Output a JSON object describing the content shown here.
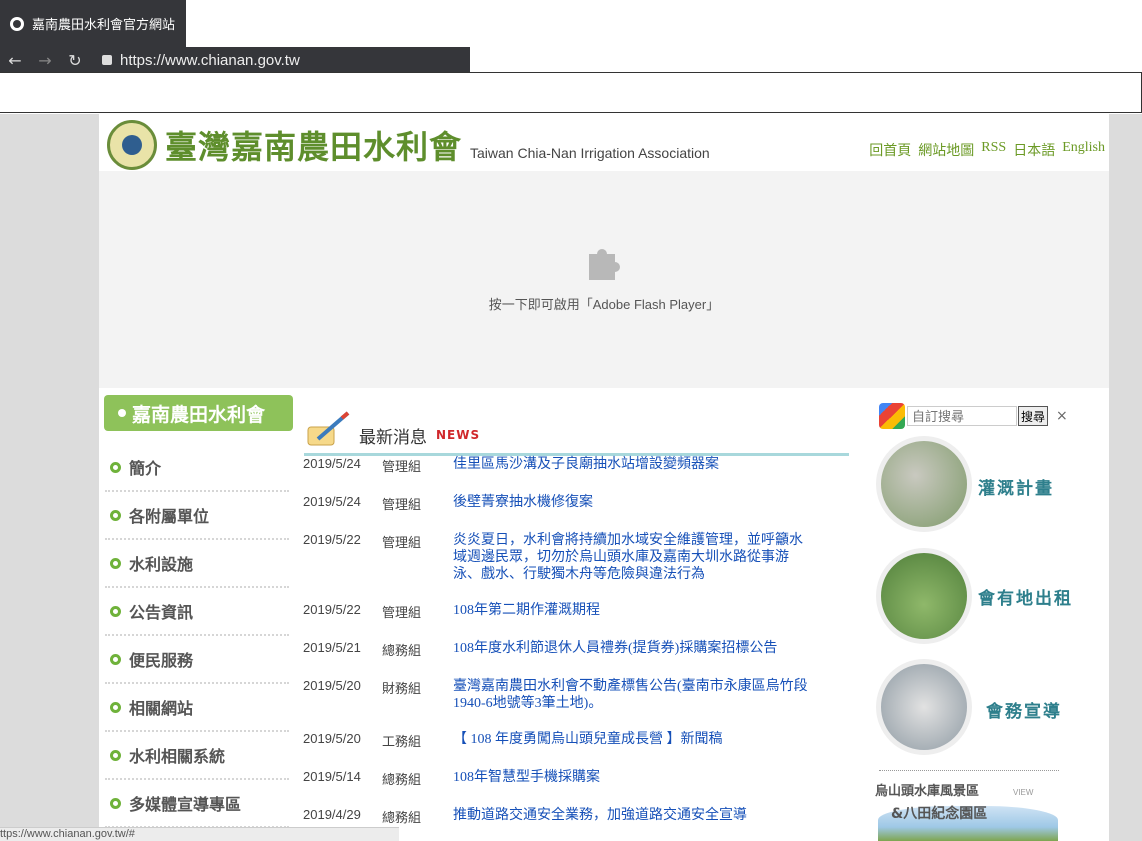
{
  "browser": {
    "tab_title": "嘉南農田水利會官方網站",
    "url": "https://www.chianan.gov.tw",
    "status_url": "ttps://www.chianan.gov.tw/#"
  },
  "header": {
    "logo_cn": "臺灣嘉南農田水利會",
    "logo_en": "Taiwan Chia-Nan Irrigation Association",
    "links": [
      "回首頁",
      "網站地圖",
      "RSS",
      "日本語",
      "English"
    ]
  },
  "flash": {
    "message": "按一下即可啟用「Adobe Flash Player」"
  },
  "sidebar": {
    "banner": "嘉南農田水利會",
    "items": [
      {
        "label": "簡介"
      },
      {
        "label": "各附屬單位"
      },
      {
        "label": "水利設施"
      },
      {
        "label": "公告資訊"
      },
      {
        "label": "便民服務"
      },
      {
        "label": "相關網站"
      },
      {
        "label": "水利相關系統"
      },
      {
        "label": "多媒體宣導專區"
      }
    ]
  },
  "news": {
    "title": "最新消息",
    "tag": "NEWS",
    "rows": [
      {
        "date": "2019/5/24",
        "dept": "管理組",
        "title": "佳里區馬沙溝及子良廟抽水站增設變頻器案"
      },
      {
        "date": "2019/5/24",
        "dept": "管理組",
        "title": "後壁菁寮抽水機修復案"
      },
      {
        "date": "2019/5/22",
        "dept": "管理組",
        "title": "炎炎夏日，水利會將持續加水域安全維護管理，並呼籲水域週邊民眾，切勿於烏山頭水庫及嘉南大圳水路從事游泳、戲水、行駛獨木舟等危險與違法行為"
      },
      {
        "date": "2019/5/22",
        "dept": "管理組",
        "title": "108年第二期作灌溉期程"
      },
      {
        "date": "2019/5/21",
        "dept": "總務組",
        "title": "108年度水利節退休人員禮券(提貨券)採購案招標公告"
      },
      {
        "date": "2019/5/20",
        "dept": "財務組",
        "title": "臺灣嘉南農田水利會不動產標售公告(臺南市永康區烏竹段1940-6地號等3筆土地)。"
      },
      {
        "date": "2019/5/20",
        "dept": "工務組",
        "title": "【 108 年度勇闖烏山頭兒童成長營 】新聞稿"
      },
      {
        "date": "2019/5/14",
        "dept": "總務組",
        "title": "108年智慧型手機採購案"
      },
      {
        "date": "2019/4/29",
        "dept": "總務組",
        "title": "推動道路交通安全業務，加強道路交通安全宣導"
      }
    ]
  },
  "search": {
    "placeholder": "自訂搜尋",
    "google_label": "Google",
    "button": "搜尋",
    "close": "×"
  },
  "promos": [
    {
      "label": "灌溉計畫",
      "color": "#7f9a6a"
    },
    {
      "label": "會有地出租",
      "color": "#5f8e4a"
    },
    {
      "label": "會務宣導",
      "color": "#8e9aa3"
    }
  ],
  "scenic": {
    "label": "烏山頭水庫風景區",
    "view": "VIEW",
    "sub": "&八田紀念園區"
  }
}
